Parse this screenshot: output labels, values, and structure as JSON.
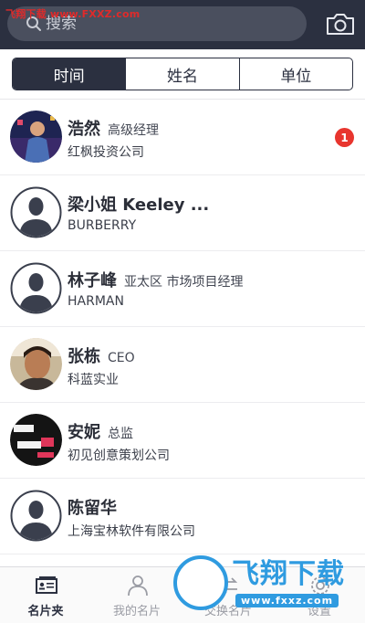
{
  "header": {
    "search_placeholder": "搜索",
    "watermark": "飞翔下载 www.FXXZ.com"
  },
  "tabs": [
    {
      "label": "时间",
      "active": true
    },
    {
      "label": "姓名",
      "active": false
    },
    {
      "label": "单位",
      "active": false
    }
  ],
  "contacts": [
    {
      "name": "浩然",
      "title": "高级经理",
      "company": "红枫投资公司",
      "avatar": "photo",
      "badge": "1"
    },
    {
      "name": "梁小姐 Keeley ...",
      "title": "",
      "company": "BURBERRY",
      "avatar": "placeholder",
      "badge": ""
    },
    {
      "name": "林子峰",
      "title": "亚太区 市场项目经理",
      "company": "HARMAN",
      "avatar": "placeholder",
      "badge": ""
    },
    {
      "name": "张栋",
      "title": "CEO",
      "company": "科蓝实业",
      "avatar": "photo",
      "badge": ""
    },
    {
      "name": "安妮",
      "title": "总监",
      "company": "初见创意策划公司",
      "avatar": "photo",
      "badge": ""
    },
    {
      "name": "陈留华",
      "title": "",
      "company": "上海宝林软件有限公司",
      "avatar": "placeholder",
      "badge": ""
    }
  ],
  "bottom_nav": [
    {
      "label": "名片夹",
      "icon": "card-holder-icon",
      "active": true
    },
    {
      "label": "我的名片",
      "icon": "person-icon",
      "active": false
    },
    {
      "label": "交换名片",
      "icon": "exchange-icon",
      "active": false
    },
    {
      "label": "设置",
      "icon": "settings-icon",
      "active": false
    }
  ],
  "watermark_logo": {
    "text": "飞翔下载",
    "url": "www.fxxz.com"
  },
  "colors": {
    "header_bg": "#2b3040",
    "badge": "#e8352e",
    "watermark": "#2f9be0"
  }
}
